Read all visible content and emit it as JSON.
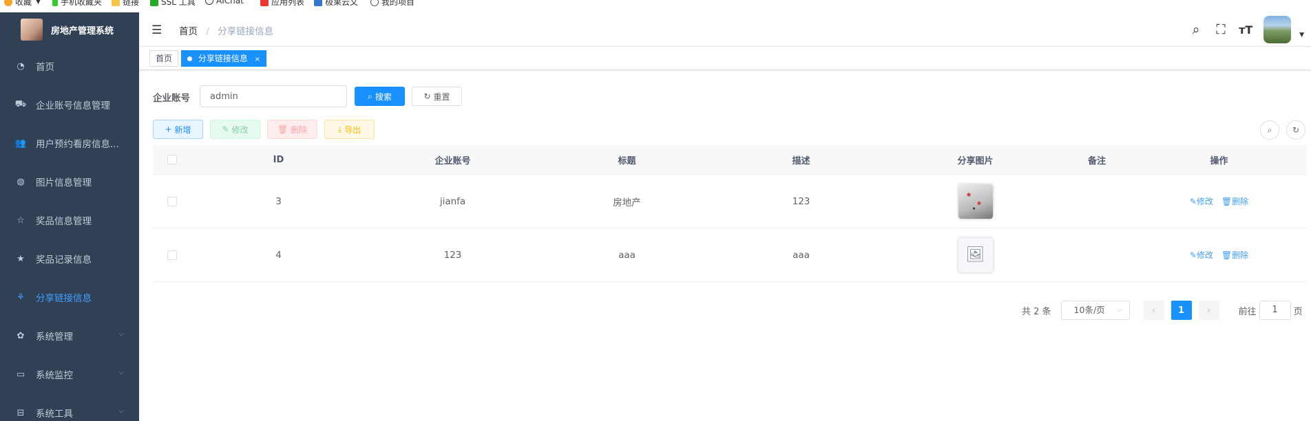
{
  "bookmarks": [
    "收藏",
    "手机收藏夹",
    "链接",
    "SSL 工具",
    "AIChat",
    "应用列表",
    "极果云文",
    "我的项目"
  ],
  "app": {
    "title": "房地产管理系统"
  },
  "sidebar": {
    "items": [
      {
        "label": "首页",
        "icon": "dashboard-icon"
      },
      {
        "label": "企业账号信息管理",
        "icon": "bus-icon"
      },
      {
        "label": "用户预约看房信息...",
        "icon": "user-icon"
      },
      {
        "label": "图片信息管理",
        "icon": "globe-icon"
      },
      {
        "label": "奖品信息管理",
        "icon": "star-outline-icon"
      },
      {
        "label": "奖品记录信息",
        "icon": "star-icon"
      },
      {
        "label": "分享链接信息",
        "icon": "share-icon",
        "active": true
      },
      {
        "label": "系统管理",
        "icon": "gear-icon",
        "expandable": true
      },
      {
        "label": "系统监控",
        "icon": "monitor-icon",
        "expandable": true
      },
      {
        "label": "系统工具",
        "icon": "toolbox-icon",
        "expandable": true
      }
    ]
  },
  "breadcrumb": {
    "home": "首页",
    "sep": "/",
    "current": "分享链接信息"
  },
  "tags": {
    "home": "首页",
    "active": "分享链接信息",
    "close": "×"
  },
  "search": {
    "label": "企业账号",
    "value": "admin",
    "search_label": "搜索",
    "reset_label": "重置"
  },
  "toolbar": {
    "add_label": "新增",
    "edit_label": "修改",
    "delete_label": "删除",
    "export_label": "导出"
  },
  "table": {
    "columns": [
      "ID",
      "企业账号",
      "标题",
      "描述",
      "分享图片",
      "备注",
      "操作"
    ],
    "rows": [
      {
        "id": "3",
        "account": "jianfa",
        "title": "房地产",
        "desc": "123",
        "image": "photo",
        "note": "",
        "edit": "修改",
        "delete": "删除"
      },
      {
        "id": "4",
        "account": "123",
        "title": "aaa",
        "desc": "aaa",
        "image": "placeholder",
        "note": "",
        "edit": "修改",
        "delete": "删除"
      }
    ]
  },
  "pagination": {
    "total": "共 2 条",
    "page_size": "10条/页",
    "current": "1",
    "goto_prefix": "前往",
    "goto_value": "1",
    "goto_suffix": "页"
  },
  "colors": {
    "primary": "#1890ff",
    "sidebar_bg": "#304156",
    "active_menu": "#409eff"
  }
}
